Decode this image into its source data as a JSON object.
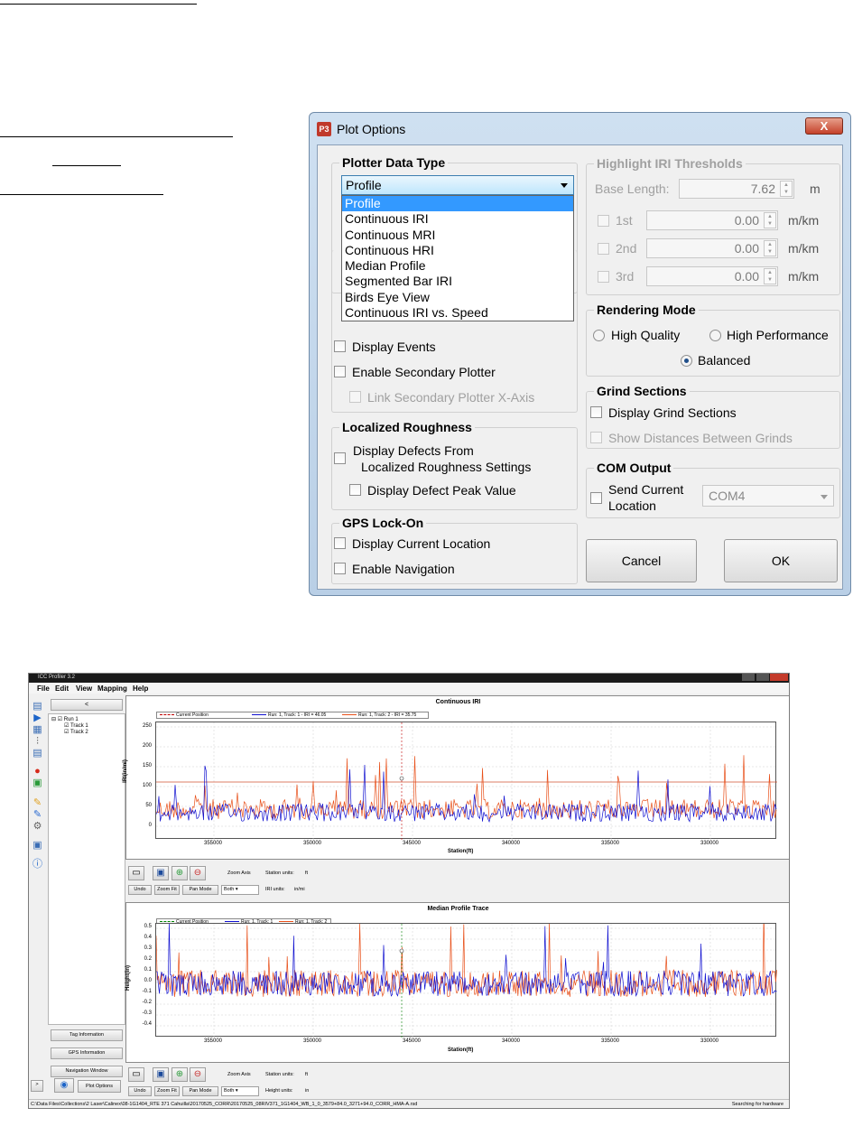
{
  "dialog": {
    "title": "Plot Options",
    "close_label": "X",
    "logo_text": "P3",
    "plotter_data_type": {
      "title": "Plotter Data Type",
      "selected": "Profile",
      "options": [
        "Profile",
        "Continuous IRI",
        "Continuous MRI",
        "Continuous HRI",
        "Median Profile",
        "Segmented Bar IRI",
        "Birds Eye View",
        "Continuous IRI vs. Speed"
      ],
      "display_events": "Display Events",
      "enable_secondary": "Enable Secondary Plotter",
      "link_secondary": "Link Secondary Plotter X-Axis"
    },
    "localized_roughness": {
      "title": "Localized Roughness",
      "display_defects_line1": "Display Defects From",
      "display_defects_line2": "Localized Roughness Settings",
      "display_defect_peak": "Display Defect Peak Value"
    },
    "gps_lock_on": {
      "title": "GPS Lock-On",
      "display_current_location": "Display Current Location",
      "enable_navigation": "Enable Navigation"
    },
    "highlight_iri": {
      "title": "Highlight IRI Thresholds",
      "base_length_label": "Base Length:",
      "base_length_value": "7.62",
      "base_length_unit": "m",
      "thresholds": [
        {
          "label": "1st",
          "value": "0.00",
          "unit": "m/km"
        },
        {
          "label": "2nd",
          "value": "0.00",
          "unit": "m/km"
        },
        {
          "label": "3rd",
          "value": "0.00",
          "unit": "m/km"
        }
      ]
    },
    "rendering_mode": {
      "title": "Rendering Mode",
      "high_quality": "High Quality",
      "high_performance": "High Performance",
      "balanced": "Balanced",
      "selected": "Balanced"
    },
    "grind_sections": {
      "title": "Grind Sections",
      "display_grind": "Display Grind Sections",
      "show_distances": "Show Distances Between Grinds"
    },
    "com_output": {
      "title": "COM Output",
      "send_line1": "Send Current",
      "send_line2": "Location",
      "port": "COM4"
    },
    "cancel_label": "Cancel",
    "ok_label": "OK"
  },
  "app": {
    "title": "ICC Profiler 3.2",
    "menu": [
      "File",
      "Edit",
      "View",
      "Mapping",
      "Help"
    ],
    "collapse_label": "<",
    "tree": {
      "run": "Run 1",
      "tracks": [
        "Track 1",
        "Track 2"
      ]
    },
    "side_buttons": [
      "Tag Information",
      "GPS Information",
      "Navigation Window"
    ],
    "expand_label": ">",
    "plot_options_label": "Plot Options",
    "plot1": {
      "title": "Continuous IRI",
      "legend": [
        "Current Position",
        "Run: 1, Track: 1 - IRI = 46.05",
        "Run: 1, Track: 2 - IRI = 35.75"
      ],
      "ylabel": "IRI(in/mi)",
      "xlabel": "Station(ft)",
      "yticks": [
        "250",
        "200",
        "150",
        "100",
        "50",
        "0"
      ],
      "xticks": [
        "355000",
        "350000",
        "345000",
        "340000",
        "335000",
        "330000"
      ]
    },
    "plot2": {
      "title": "Median Profile Trace",
      "legend": [
        "Current Position",
        "Run: 1, Track: 1",
        "Run: 1, Track: 2"
      ],
      "ylabel": "Height(in)",
      "xlabel": "Station(ft)",
      "yticks": [
        "0.5",
        "0.4",
        "0.3",
        "0.2",
        "0.1",
        "0.0",
        "-0.1",
        "-0.2",
        "-0.3",
        "-0.4"
      ],
      "xticks": [
        "355000",
        "350000",
        "345000",
        "340000",
        "335000",
        "330000"
      ]
    },
    "controls1": {
      "zoom_axis": "Zoom Axis",
      "station_units": "Station units:",
      "station_unit_value": "ft",
      "undo": "Undo",
      "zoom_fit": "Zoom Fit",
      "pan_mode": "Pan Mode",
      "both": "Both",
      "second_units": "IRI units:",
      "second_unit_value": "in/mi"
    },
    "controls2": {
      "zoom_axis": "Zoom Axis",
      "station_units": "Station units:",
      "station_unit_value": "ft",
      "undo": "Undo",
      "zoom_fit": "Zoom Fit",
      "pan_mode": "Pan Mode",
      "both": "Both",
      "second_units": "Height units:",
      "second_unit_value": "in"
    },
    "status_path": "C:\\Data Files\\Collections\\2 Laser\\Calinex\\08-1G1404_RTE 371 Cahuilla\\20170525_CORR\\20170525_08RIV371_1G1404_WB_1_0_3579+84.0_3271+94.0_CORR_HMA-A.rsd",
    "status_right": "Searching for hardware",
    "colors": {
      "track1": "#1010d0",
      "track2": "#e8501a",
      "current": "#c00000"
    }
  }
}
